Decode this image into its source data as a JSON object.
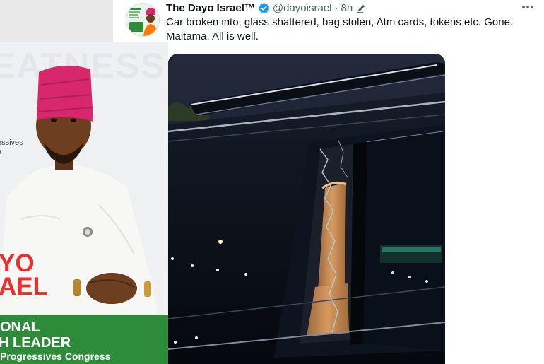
{
  "tweet": {
    "author_name": "The Dayo Israel™",
    "handle": "@dayoisrael",
    "separator": "·",
    "time": "8h",
    "text": "Car broken into, glass shattered, bag stolen, Atm cards, tokens etc. Gone. Maitama. All is well.",
    "icons": [
      "verified-badge-icon",
      "edited-icon",
      "more-options-icon"
    ]
  },
  "poster": {
    "background_word": "EATNESS",
    "side_text_line1": "essives",
    "side_text_line2": "a",
    "name_line1": "YO",
    "name_line2": "AEL",
    "band_line1": "ONAL",
    "band_line2": "H LEADER",
    "band_line3": "Progressives Congress",
    "colors": {
      "cap": "#d6286b",
      "name_red": "#e8312f",
      "band_green": "#2e8b3a"
    }
  },
  "colors": {
    "text": "#0f1419",
    "secondary": "#536471",
    "verified": "#1d9bf0"
  }
}
